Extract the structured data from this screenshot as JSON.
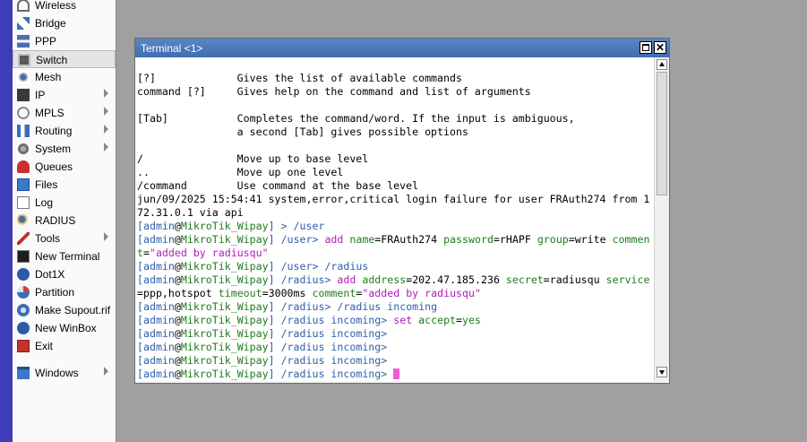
{
  "menu": {
    "items": [
      {
        "label": "Wireless",
        "icon": "wireless-icon",
        "arrow": false
      },
      {
        "label": "Bridge",
        "icon": "bridge-icon",
        "arrow": false
      },
      {
        "label": "PPP",
        "icon": "ppp-icon",
        "arrow": false
      },
      {
        "label": "Switch",
        "icon": "switch-icon",
        "arrow": false,
        "selected": true
      },
      {
        "label": "Mesh",
        "icon": "mesh-icon",
        "arrow": false
      },
      {
        "label": "IP",
        "icon": "ip-icon",
        "arrow": true
      },
      {
        "label": "MPLS",
        "icon": "mpls-icon",
        "arrow": true
      },
      {
        "label": "Routing",
        "icon": "routing-icon",
        "arrow": true
      },
      {
        "label": "System",
        "icon": "system-icon",
        "arrow": true
      },
      {
        "label": "Queues",
        "icon": "queues-icon",
        "arrow": false
      },
      {
        "label": "Files",
        "icon": "files-icon",
        "arrow": false
      },
      {
        "label": "Log",
        "icon": "log-icon",
        "arrow": false
      },
      {
        "label": "RADIUS",
        "icon": "radius-icon",
        "arrow": false
      },
      {
        "label": "Tools",
        "icon": "tools-icon",
        "arrow": true
      },
      {
        "label": "New Terminal",
        "icon": "terminal-icon",
        "arrow": false
      },
      {
        "label": "Dot1X",
        "icon": "dot1x-icon",
        "arrow": false
      },
      {
        "label": "Partition",
        "icon": "partition-icon",
        "arrow": false
      },
      {
        "label": "Make Supout.rif",
        "icon": "supout-icon",
        "arrow": false
      },
      {
        "label": "New WinBox",
        "icon": "winbox-icon",
        "arrow": false
      },
      {
        "label": "Exit",
        "icon": "exit-icon",
        "arrow": false
      },
      {
        "label": "Windows",
        "icon": "windows-icon",
        "arrow": true
      }
    ]
  },
  "terminal": {
    "title": "Terminal <1>",
    "close_glyph": "✕",
    "lines": [
      [
        {
          "t": "[?]             Gives the list of available commands"
        }
      ],
      [
        {
          "t": "command [?]     Gives help on the command and list of arguments"
        }
      ],
      [
        {
          "t": ""
        }
      ],
      [
        {
          "t": "[Tab]           Completes the command/word. If the input is ambiguous,"
        }
      ],
      [
        {
          "t": "                a second [Tab] gives possible options"
        }
      ],
      [
        {
          "t": ""
        }
      ],
      [
        {
          "t": "/               Move up to base level"
        }
      ],
      [
        {
          "t": "..              Move up one level"
        }
      ],
      [
        {
          "t": "/command        Use command at the base level"
        }
      ],
      [
        {
          "t": "jun/09/2025 15:54:41 system,error,critical login failure for user FRAuth274 from 1"
        }
      ],
      [
        {
          "t": "72.31.0.1 via api"
        }
      ],
      [
        {
          "t": "[",
          "c": "p"
        },
        {
          "t": "admin",
          "c": "p"
        },
        {
          "t": "@"
        },
        {
          "t": "MikroTik_Wipay",
          "c": "g"
        },
        {
          "t": "] > ",
          "c": "p"
        },
        {
          "t": "/user",
          "c": "dir"
        }
      ],
      [
        {
          "t": "[",
          "c": "p"
        },
        {
          "t": "admin",
          "c": "p"
        },
        {
          "t": "@"
        },
        {
          "t": "MikroTik_Wipay",
          "c": "g"
        },
        {
          "t": "] ",
          "c": "p"
        },
        {
          "t": "/user",
          "c": "dir"
        },
        {
          "t": "> ",
          "c": "p"
        },
        {
          "t": "add ",
          "c": "cmd"
        },
        {
          "t": "name",
          "c": "g"
        },
        {
          "t": "="
        },
        {
          "t": "FRAuth274 "
        },
        {
          "t": "password",
          "c": "g"
        },
        {
          "t": "="
        },
        {
          "t": "rHAPF "
        },
        {
          "t": "group",
          "c": "g"
        },
        {
          "t": "="
        },
        {
          "t": "write "
        },
        {
          "t": "commen",
          "c": "g"
        }
      ],
      [
        {
          "t": "t",
          "c": "g"
        },
        {
          "t": "="
        },
        {
          "t": "\"added by radiusqu\"",
          "c": "cmd"
        }
      ],
      [
        {
          "t": "[",
          "c": "p"
        },
        {
          "t": "admin",
          "c": "p"
        },
        {
          "t": "@"
        },
        {
          "t": "MikroTik_Wipay",
          "c": "g"
        },
        {
          "t": "] ",
          "c": "p"
        },
        {
          "t": "/user",
          "c": "dir"
        },
        {
          "t": "> ",
          "c": "p"
        },
        {
          "t": "/radius",
          "c": "dir"
        }
      ],
      [
        {
          "t": "[",
          "c": "p"
        },
        {
          "t": "admin",
          "c": "p"
        },
        {
          "t": "@"
        },
        {
          "t": "MikroTik_Wipay",
          "c": "g"
        },
        {
          "t": "] ",
          "c": "p"
        },
        {
          "t": "/radius",
          "c": "dir"
        },
        {
          "t": "> ",
          "c": "p"
        },
        {
          "t": "add ",
          "c": "cmd"
        },
        {
          "t": "address",
          "c": "g"
        },
        {
          "t": "="
        },
        {
          "t": "202.47.185.236 "
        },
        {
          "t": "secret",
          "c": "g"
        },
        {
          "t": "="
        },
        {
          "t": "radiusqu "
        },
        {
          "t": "service",
          "c": "g"
        }
      ],
      [
        {
          "t": "="
        },
        {
          "t": "ppp,hotspot "
        },
        {
          "t": "timeout",
          "c": "g"
        },
        {
          "t": "="
        },
        {
          "t": "3000ms "
        },
        {
          "t": "comment",
          "c": "g"
        },
        {
          "t": "="
        },
        {
          "t": "\"added by radiusqu\"",
          "c": "cmd"
        }
      ],
      [
        {
          "t": "[",
          "c": "p"
        },
        {
          "t": "admin",
          "c": "p"
        },
        {
          "t": "@"
        },
        {
          "t": "MikroTik_Wipay",
          "c": "g"
        },
        {
          "t": "] ",
          "c": "p"
        },
        {
          "t": "/radius",
          "c": "dir"
        },
        {
          "t": "> ",
          "c": "p"
        },
        {
          "t": "/radius incoming",
          "c": "dir"
        }
      ],
      [
        {
          "t": "[",
          "c": "p"
        },
        {
          "t": "admin",
          "c": "p"
        },
        {
          "t": "@"
        },
        {
          "t": "MikroTik_Wipay",
          "c": "g"
        },
        {
          "t": "] ",
          "c": "p"
        },
        {
          "t": "/radius incoming",
          "c": "dir"
        },
        {
          "t": "> ",
          "c": "p"
        },
        {
          "t": "set ",
          "c": "cmd"
        },
        {
          "t": "accept",
          "c": "g"
        },
        {
          "t": "="
        },
        {
          "t": "yes",
          "c": "g"
        }
      ],
      [
        {
          "t": "[",
          "c": "p"
        },
        {
          "t": "admin",
          "c": "p"
        },
        {
          "t": "@"
        },
        {
          "t": "MikroTik_Wipay",
          "c": "g"
        },
        {
          "t": "] ",
          "c": "p"
        },
        {
          "t": "/radius incoming",
          "c": "dir"
        },
        {
          "t": ">",
          "c": "p"
        }
      ],
      [
        {
          "t": "[",
          "c": "p"
        },
        {
          "t": "admin",
          "c": "p"
        },
        {
          "t": "@"
        },
        {
          "t": "MikroTik_Wipay",
          "c": "g"
        },
        {
          "t": "] ",
          "c": "p"
        },
        {
          "t": "/radius incoming",
          "c": "dir"
        },
        {
          "t": ">",
          "c": "p"
        }
      ],
      [
        {
          "t": "[",
          "c": "p"
        },
        {
          "t": "admin",
          "c": "p"
        },
        {
          "t": "@"
        },
        {
          "t": "MikroTik_Wipay",
          "c": "g"
        },
        {
          "t": "] ",
          "c": "p"
        },
        {
          "t": "/radius incoming",
          "c": "dir"
        },
        {
          "t": ">",
          "c": "p"
        }
      ],
      [
        {
          "t": "[",
          "c": "p"
        },
        {
          "t": "admin",
          "c": "p"
        },
        {
          "t": "@"
        },
        {
          "t": "MikroTik_Wipay",
          "c": "g"
        },
        {
          "t": "] ",
          "c": "p"
        },
        {
          "t": "/radius incoming",
          "c": "dir"
        },
        {
          "t": "> ",
          "c": "p"
        },
        {
          "cursor": true
        }
      ]
    ]
  },
  "colors": {
    "sidebar_stripe": "#3d3db8",
    "titlebar": "#4a78b8",
    "prompt": "#2e5ea8",
    "host": "#1f7a1f",
    "command": "#b01cb8",
    "cursor": "#f05ad2"
  }
}
